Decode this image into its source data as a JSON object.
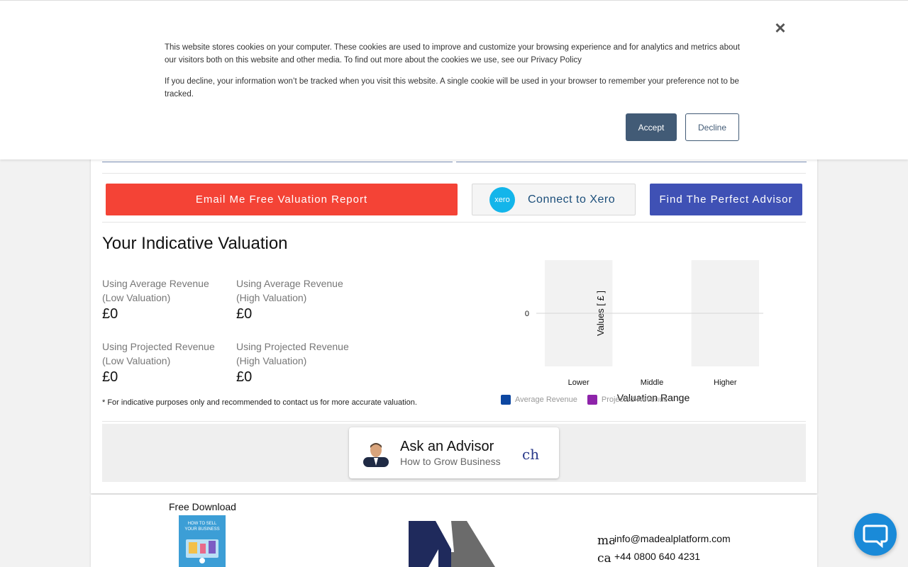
{
  "cookie_banner": {
    "paragraph_1": "This website stores cookies on your computer. These cookies are used to improve and customize your browsing experience and for analytics and metrics about our visitors both on this website and other media. To find out more about the cookies we use, see our Privacy Policy",
    "paragraph_2": "If you decline, your information won’t be tracked when you visit this website. A single cookie will be used in your browser to remember your preference not to be tracked.",
    "accept_label": "Accept",
    "decline_label": "Decline",
    "close_symbol": "×"
  },
  "actions": {
    "email_label": "Email Me Free Valuation Report",
    "xero_logo_text": "xero",
    "xero_label": "Connect to Xero",
    "advisor_label": "Find The Perfect Advisor"
  },
  "valuation": {
    "title": "Your Indicative Valuation",
    "items": [
      {
        "label": "Using Average Revenue (Low Valuation)",
        "value": "£0"
      },
      {
        "label": "Using Average Revenue (High Valuation)",
        "value": "£0"
      },
      {
        "label": "Using Projected Revenue (Low Valuation)",
        "value": "£0"
      },
      {
        "label": "Using Projected Revenue (High Valuation)",
        "value": "£0"
      }
    ],
    "note": "* For indicative purposes only and recommended to contact us for more accurate valuation."
  },
  "chart_data": {
    "type": "bar",
    "categories": [
      "Lower",
      "Middle",
      "Higher"
    ],
    "series": [
      {
        "name": "Average Revenue",
        "values": [
          0,
          0,
          0
        ]
      },
      {
        "name": "Projected Revenue",
        "values": [
          0,
          0,
          0
        ]
      }
    ],
    "xlabel": "Valuation Range",
    "ylabel": "Values [ £ ]",
    "y_ticks": [
      "0"
    ],
    "legend_position": "bottom-left",
    "colors": {
      "Average Revenue": "#0d47a1",
      "Projected Revenue": "#8e24aa",
      "placeholder_bar": "#f2f2f2"
    }
  },
  "ask_advisor": {
    "title": "Ask an Advisor",
    "subtitle": "How to Grow Business",
    "signature": "ch"
  },
  "footer": {
    "free_download_label": "Free Download",
    "book_title": "HOW TO SELL YOUR BUSINESS",
    "email_glyph": "ma",
    "email": "info@madealplatform.com",
    "phone_glyph": "ca",
    "phone": "+44 0800 640 4231"
  },
  "colors": {
    "email_button": "#f44336",
    "advisor_button": "#3f51b5",
    "accept_button": "#425b76",
    "chat_button": "#1a8ad8"
  }
}
